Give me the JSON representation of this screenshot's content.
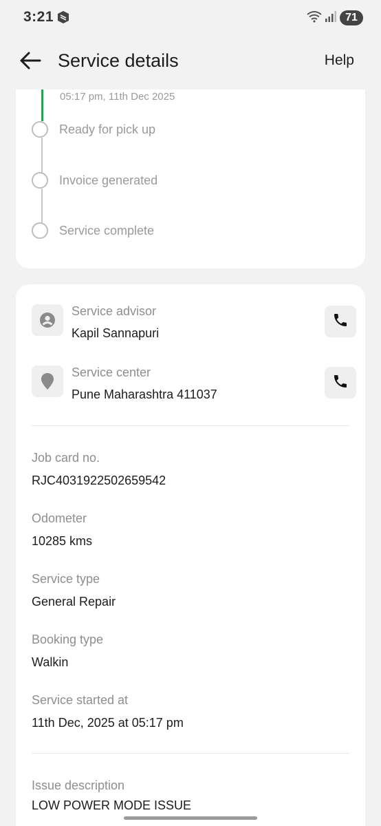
{
  "status_bar": {
    "time": "3:21",
    "battery": "71",
    "icons": [
      "app-notification-icon",
      "wifi-icon",
      "signal-icon",
      "battery-icon"
    ]
  },
  "header": {
    "title": "Service details",
    "help_label": "Help",
    "back_icon": "arrow-left-icon"
  },
  "timeline": {
    "last_completed_timestamp": "05:17 pm, 11th Dec 2025",
    "steps": [
      {
        "label": "Ready for pick up"
      },
      {
        "label": "Invoice generated"
      },
      {
        "label": "Service complete"
      }
    ],
    "colors": {
      "completed": "#2e9e5b",
      "pending": "#bdbdbd"
    }
  },
  "contacts": {
    "advisor": {
      "label": "Service advisor",
      "value": "Kapil Sannapuri",
      "icon": "person-icon",
      "action_icon": "phone-icon"
    },
    "center": {
      "label": "Service center",
      "value": "Pune Maharashtra 411037",
      "icon": "location-pin-icon",
      "action_icon": "phone-icon"
    }
  },
  "details": {
    "job_card": {
      "label": "Job card no.",
      "value": "RJC4031922502659542"
    },
    "odometer": {
      "label": "Odometer",
      "value": "10285 kms"
    },
    "service_type": {
      "label": "Service type",
      "value": "General Repair"
    },
    "booking_type": {
      "label": "Booking type",
      "value": "Walkin"
    },
    "service_started": {
      "label": "Service started at",
      "value": "11th Dec, 2025 at 05:17 pm"
    }
  },
  "issue": {
    "label": "Issue description",
    "value": "LOW POWER MODE ISSUE"
  }
}
